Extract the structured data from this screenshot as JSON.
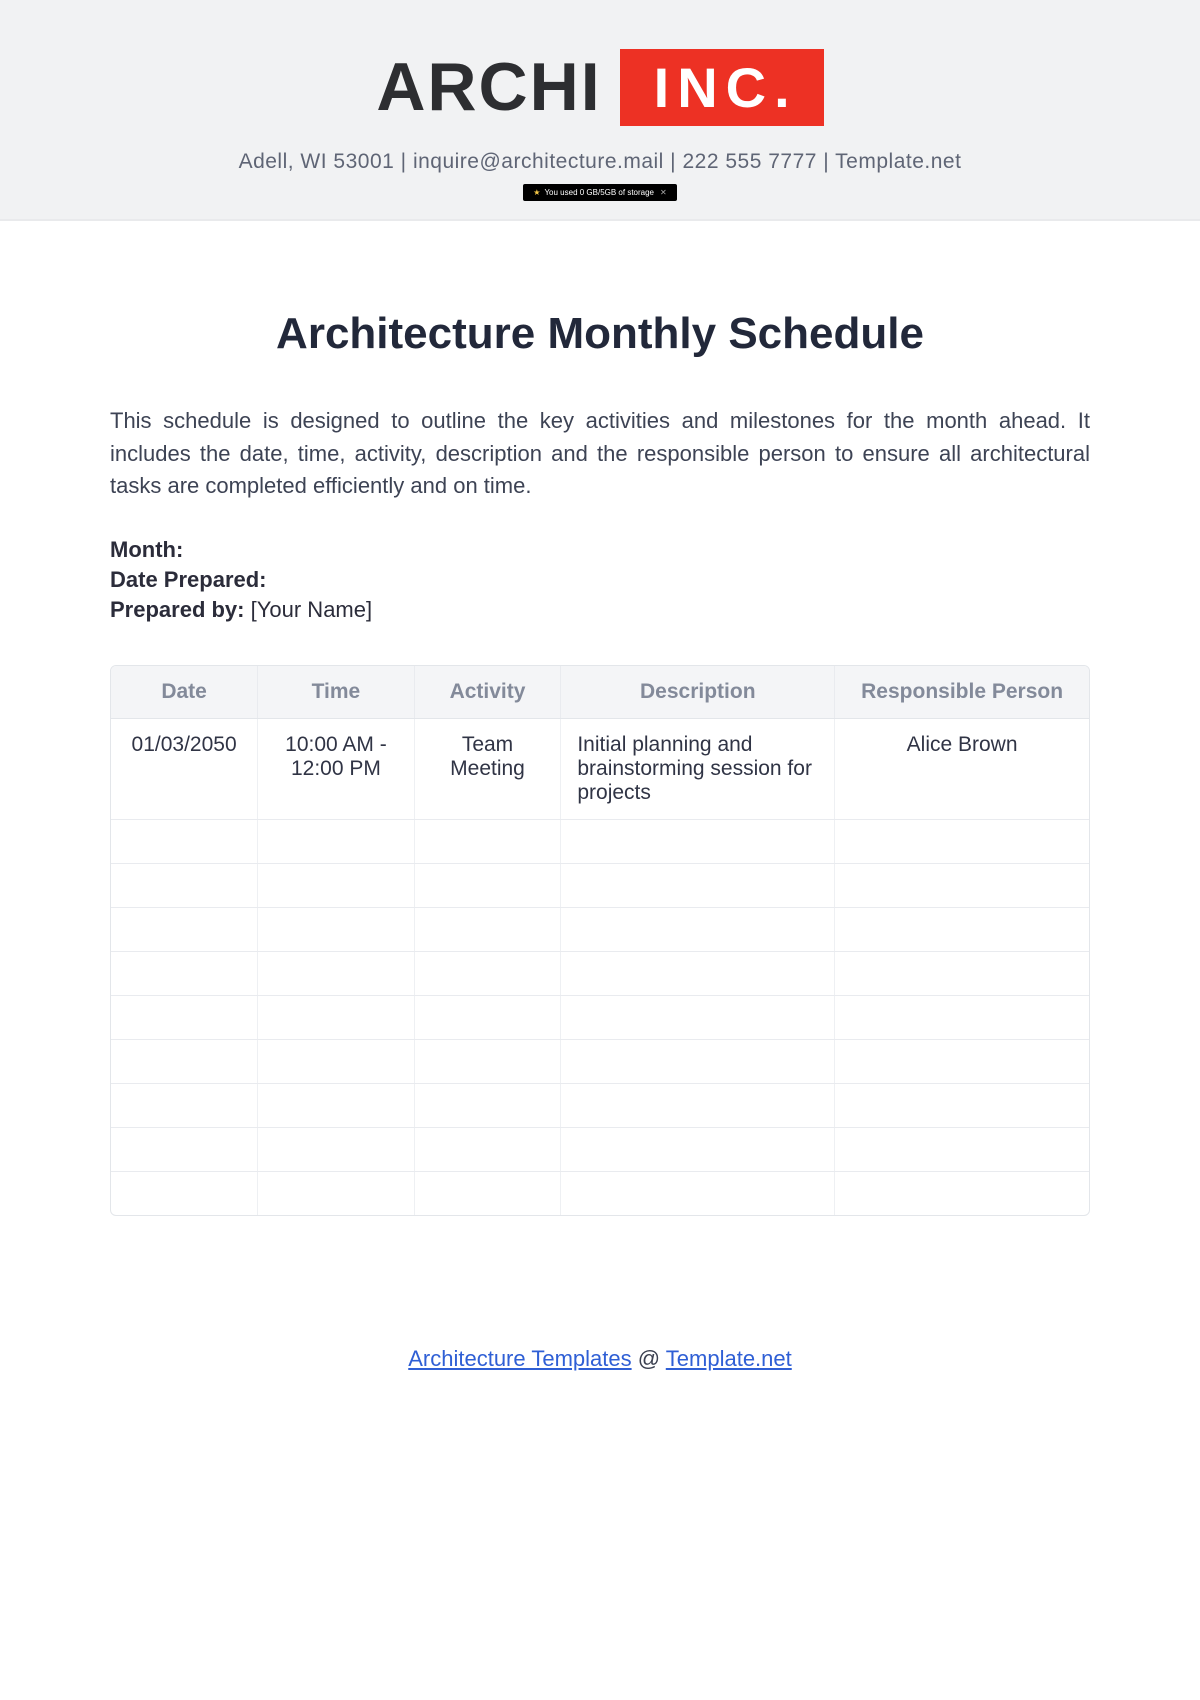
{
  "header": {
    "logo_left": "ARCHI",
    "logo_right": "INC.",
    "contact": "Adell, WI 53001 | inquire@architecture.mail | 222 555 7777 | Template.net",
    "storage_pill": "You used 0 GB/5GB of storage"
  },
  "title": "Architecture Monthly Schedule",
  "intro": "This schedule is designed to outline the key activities and milestones for the month ahead. It includes the date, time, activity, description and the responsible person to ensure all architectural tasks are completed efficiently and on time.",
  "meta": {
    "month_label": "Month:",
    "month_value": "",
    "date_prepared_label": "Date Prepared:",
    "date_prepared_value": "",
    "prepared_by_label": "Prepared by:",
    "prepared_by_value": "[Your Name]"
  },
  "table": {
    "headers": [
      "Date",
      "Time",
      "Activity",
      "Description",
      "Responsible Person"
    ],
    "rows": [
      {
        "date": "01/03/2050",
        "time": "10:00 AM - 12:00 PM",
        "activity": "Team Meeting",
        "description": "Initial planning and brainstorming session for projects",
        "responsible": "Alice Brown"
      },
      {
        "date": "",
        "time": "",
        "activity": "",
        "description": "",
        "responsible": ""
      },
      {
        "date": "",
        "time": "",
        "activity": "",
        "description": "",
        "responsible": ""
      },
      {
        "date": "",
        "time": "",
        "activity": "",
        "description": "",
        "responsible": ""
      },
      {
        "date": "",
        "time": "",
        "activity": "",
        "description": "",
        "responsible": ""
      },
      {
        "date": "",
        "time": "",
        "activity": "",
        "description": "",
        "responsible": ""
      },
      {
        "date": "",
        "time": "",
        "activity": "",
        "description": "",
        "responsible": ""
      },
      {
        "date": "",
        "time": "",
        "activity": "",
        "description": "",
        "responsible": ""
      },
      {
        "date": "",
        "time": "",
        "activity": "",
        "description": "",
        "responsible": ""
      },
      {
        "date": "",
        "time": "",
        "activity": "",
        "description": "",
        "responsible": ""
      }
    ]
  },
  "footer": {
    "link1_text": "Architecture Templates",
    "separator": " @ ",
    "link2_text": "Template.net"
  }
}
